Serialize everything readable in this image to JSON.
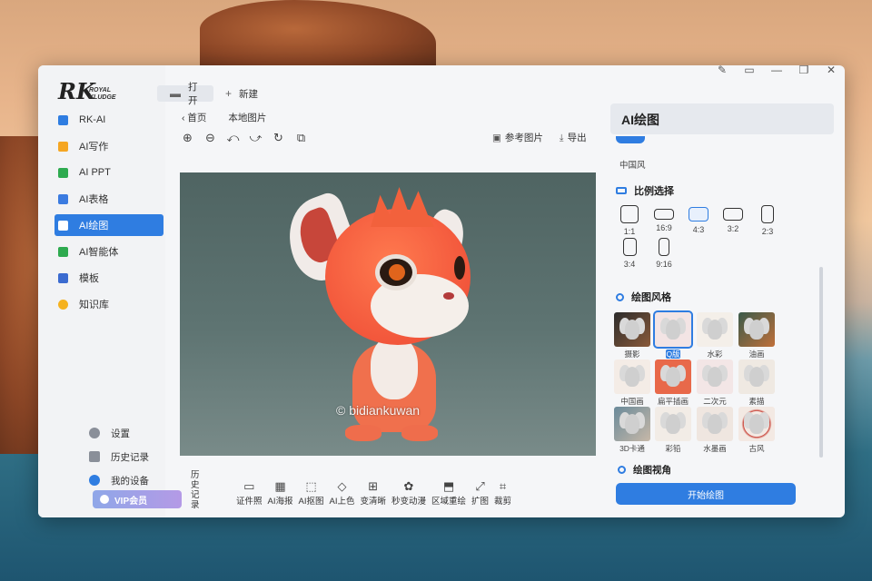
{
  "brand": {
    "logo": "RK",
    "logo_sub_1": "ROYAL",
    "logo_sub_2": "KLUDGE"
  },
  "sidebar": {
    "items": [
      {
        "label": "RK-AI",
        "color": "#2f7de1",
        "icon": "rk-ai-icon"
      },
      {
        "label": "AI写作",
        "color": "#f5a623",
        "icon": "writing-icon"
      },
      {
        "label": "AI PPT",
        "color": "#2eaa4f",
        "icon": "ppt-icon"
      },
      {
        "label": "AI表格",
        "color": "#3b7be0",
        "icon": "table-icon"
      },
      {
        "label": "AI绘图",
        "color": "#f5a623",
        "icon": "drawing-icon",
        "active": true
      },
      {
        "label": "AI智能体",
        "color": "#2eaa4f",
        "icon": "agent-icon"
      },
      {
        "label": "模板",
        "color": "#3b6bd0",
        "icon": "template-icon"
      },
      {
        "label": "知识库",
        "color": "#f5b21f",
        "icon": "knowledge-icon"
      }
    ],
    "bottom": [
      {
        "label": "设置",
        "icon": "gear-icon"
      },
      {
        "label": "历史记录",
        "icon": "history-icon"
      },
      {
        "label": "我的设备",
        "icon": "device-icon"
      }
    ],
    "vip": "VIP会员"
  },
  "topbar": {
    "tab_open": "打开",
    "tab_new": "新建",
    "window_buttons": [
      "edit-icon",
      "feedback-icon",
      "minimize-icon",
      "restore-icon",
      "close-icon"
    ]
  },
  "main": {
    "back": "首页",
    "breadcrumb_current": "本地图片",
    "tools": [
      "zoom-in-icon",
      "zoom-out-icon",
      "rotate-left-icon",
      "rotate-right-icon",
      "refresh-icon",
      "compare-icon"
    ],
    "reference_image": "参考图片",
    "export": "导出",
    "history_label": "历史记录",
    "bottom_tools": [
      "证件照",
      "AI海报",
      "AI抠图",
      "AI上色",
      "变清晰",
      "秒变动漫",
      "区域重绘",
      "扩图",
      "裁剪"
    ],
    "watermark": "© bidiankuwan"
  },
  "panel": {
    "title": "AI绘图",
    "prev_style": "中国风",
    "ratio_title": "比例选择",
    "ratios": [
      "1:1",
      "16:9",
      "4:3",
      "3:2",
      "2:3",
      "3:4",
      "9:16"
    ],
    "active_ratio": "4:3",
    "style_title": "绘图风格",
    "styles": [
      "摄影",
      "Q版",
      "水彩",
      "油画",
      "中国画",
      "扁平插画",
      "二次元",
      "素描",
      "3D卡通",
      "彩铅",
      "水墨画",
      "古风"
    ],
    "active_style": "Q版",
    "view_title": "绘图视角",
    "start_button": "开始绘图",
    "accent": "#2f7de1"
  }
}
